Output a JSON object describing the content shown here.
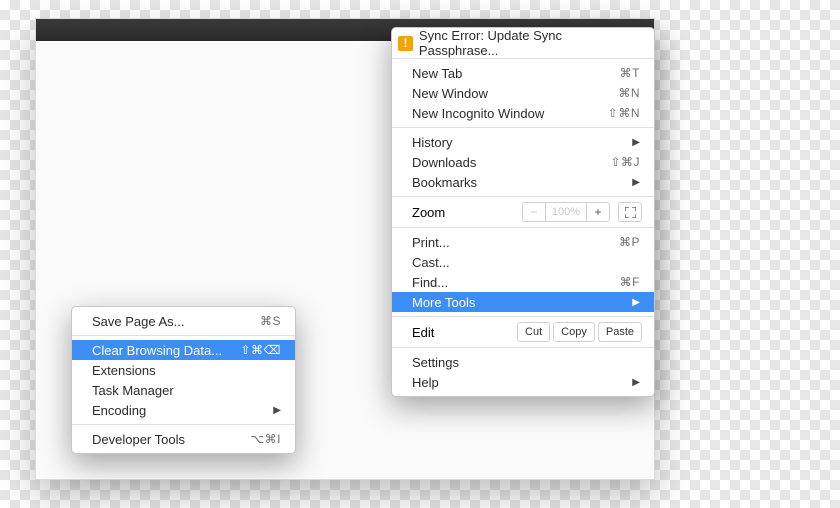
{
  "sync": {
    "label": "Sync Error: Update Sync Passphrase..."
  },
  "main": {
    "newTab": {
      "label": "New Tab",
      "shortcut": "⌘T"
    },
    "newWindow": {
      "label": "New Window",
      "shortcut": "⌘N"
    },
    "newIncognito": {
      "label": "New Incognito Window",
      "shortcut": "⇧⌘N"
    },
    "history": {
      "label": "History"
    },
    "downloads": {
      "label": "Downloads",
      "shortcut": "⇧⌘J"
    },
    "bookmarks": {
      "label": "Bookmarks"
    },
    "zoom": {
      "label": "Zoom",
      "pct": "100%",
      "minus": "−",
      "plus": "+"
    },
    "print": {
      "label": "Print...",
      "shortcut": "⌘P"
    },
    "cast": {
      "label": "Cast..."
    },
    "find": {
      "label": "Find...",
      "shortcut": "⌘F"
    },
    "moreTools": {
      "label": "More Tools"
    },
    "edit": {
      "label": "Edit",
      "cut": "Cut",
      "copy": "Copy",
      "paste": "Paste"
    },
    "settings": {
      "label": "Settings"
    },
    "help": {
      "label": "Help"
    }
  },
  "sub": {
    "savePage": {
      "label": "Save Page As...",
      "shortcut": "⌘S"
    },
    "clearData": {
      "label": "Clear Browsing Data...",
      "shortcut": "⇧⌘⌫"
    },
    "extensions": {
      "label": "Extensions"
    },
    "taskManager": {
      "label": "Task Manager"
    },
    "encoding": {
      "label": "Encoding"
    },
    "devTools": {
      "label": "Developer Tools",
      "shortcut": "⌥⌘I"
    }
  }
}
